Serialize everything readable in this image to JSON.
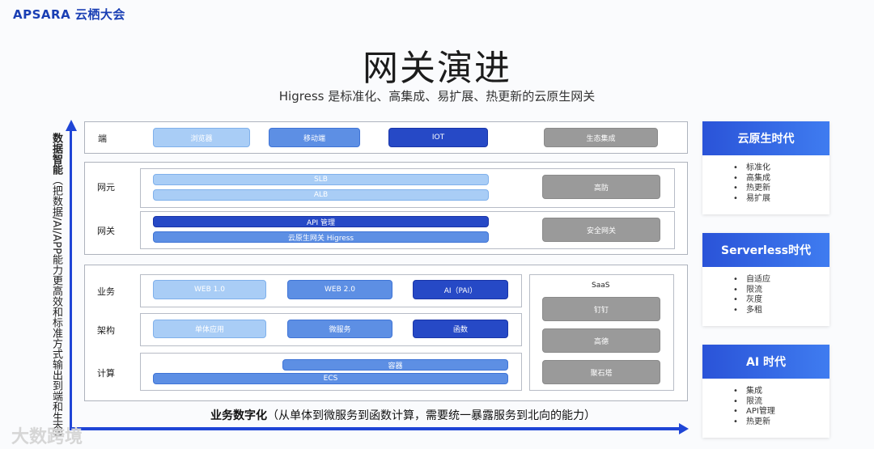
{
  "brand": {
    "logo": "APSARA 云栖大会"
  },
  "title": "网关演进",
  "subtitle": "Higress 是标准化、高集成、易扩展、热更新的云原生网关",
  "y_axis": {
    "bold": "数据智能",
    "rest": "（把数据/AI/APP能力更高效和标准方式输出到端和生态）"
  },
  "x_axis": {
    "bold": "业务数字化",
    "rest": "（从单体到微服务到函数计算，需要统一暴露服务到北向的能力）"
  },
  "watermark": "大数跨境",
  "layers": {
    "duan": {
      "label": "端",
      "chips": [
        "浏览器",
        "移动端",
        "IOT",
        "生态集成"
      ]
    },
    "wangyuan": {
      "label": "网元",
      "chips": [
        "SLB",
        "ALB"
      ],
      "side": "高防"
    },
    "wangguan": {
      "label": "网关",
      "chips": [
        "API 管理",
        "云原生网关 Higress"
      ],
      "side": "安全网关"
    },
    "yewu": {
      "label": "业务",
      "chips": [
        "WEB 1.0",
        "WEB 2.0",
        "AI（PAI）"
      ]
    },
    "jiagou": {
      "label": "架构",
      "chips": [
        "单体应用",
        "微服务",
        "函数"
      ]
    },
    "jisuan": {
      "label": "计算",
      "chips": [
        "容器",
        "ECS"
      ]
    },
    "saas": {
      "title": "SaaS",
      "items": [
        "钉钉",
        "高德",
        "聚石塔"
      ]
    }
  },
  "cards": [
    {
      "title": "云原生时代",
      "items": [
        "标准化",
        "高集成",
        "热更新",
        "易扩展"
      ]
    },
    {
      "title": "Serverless时代",
      "items": [
        "自适应",
        "限流",
        "灰度",
        "多租"
      ]
    },
    {
      "title": "AI 时代",
      "items": [
        "集成",
        "限流",
        "API管理",
        "热更新"
      ]
    }
  ],
  "colors": {
    "accent": "#1f45d6",
    "light": "#a9cdf6",
    "mid": "#5d8fe4",
    "dark": "#2649c6",
    "gray": "#9a9a9a"
  }
}
